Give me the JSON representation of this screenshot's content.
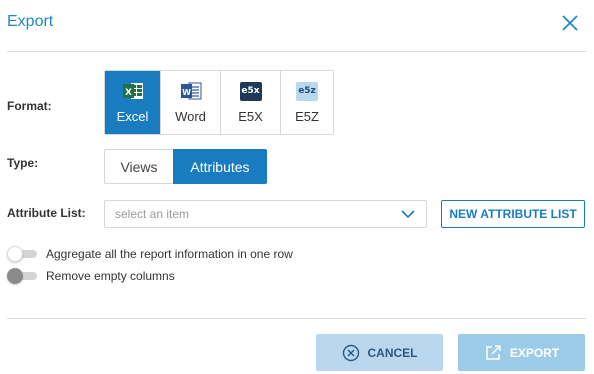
{
  "dialog": {
    "title": "Export",
    "close_icon": "close-icon"
  },
  "format": {
    "label": "Format:",
    "options": [
      {
        "name": "Excel",
        "icon": "excel-icon",
        "selected": true
      },
      {
        "name": "Word",
        "icon": "word-icon",
        "selected": false
      },
      {
        "name": "E5X",
        "icon": "e5x-icon",
        "icon_text": "e5x",
        "selected": false
      },
      {
        "name": "E5Z",
        "icon": "e5z-icon",
        "icon_text": "e5z",
        "selected": false
      }
    ]
  },
  "type": {
    "label": "Type:",
    "options": [
      {
        "name": "Views",
        "selected": false
      },
      {
        "name": "Attributes",
        "selected": true
      }
    ]
  },
  "attribute_list": {
    "label": "Attribute List:",
    "placeholder": "select an item",
    "new_button_label": "NEW ATTRIBUTE LIST"
  },
  "toggles": [
    {
      "label": "Aggregate all the report information in one row",
      "on": false
    },
    {
      "label": "Remove empty columns",
      "on": false
    }
  ],
  "footer": {
    "cancel_label": "CANCEL",
    "export_label": "EXPORT"
  },
  "colors": {
    "accent": "#1a7cc0",
    "title": "#1f88c6",
    "cancel_bg": "#b9d7ef",
    "export_bg": "#9ccbe8"
  }
}
